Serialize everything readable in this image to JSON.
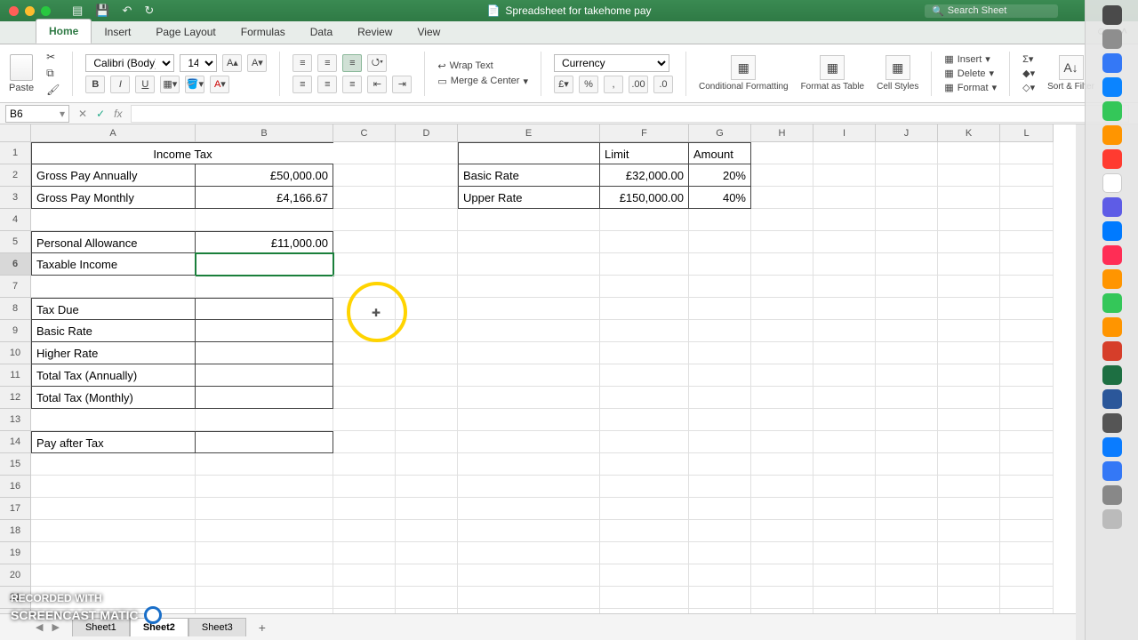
{
  "window": {
    "title": "Spreadsheet for takehome pay",
    "search_placeholder": "Search Sheet"
  },
  "tabs": [
    "Home",
    "Insert",
    "Page Layout",
    "Formulas",
    "Data",
    "Review",
    "View"
  ],
  "active_tab": "Home",
  "ribbon": {
    "paste": "Paste",
    "font_name": "Calibri (Body)",
    "font_size": "14",
    "bold": "B",
    "italic": "I",
    "underline": "U",
    "wrap": "Wrap Text",
    "merge": "Merge & Center",
    "number_format": "Currency",
    "cond": "Conditional Formatting",
    "as_table": "Format as Table",
    "cell_styles": "Cell Styles",
    "insert": "Insert",
    "delete": "Delete",
    "format": "Format",
    "sort": "Sort & Filter"
  },
  "namebox": "B6",
  "fx_label": "fx",
  "columns": [
    "A",
    "B",
    "C",
    "D",
    "E",
    "F",
    "G",
    "H",
    "I",
    "J",
    "K",
    "L"
  ],
  "row_count": 22,
  "selected_row": 6,
  "cells": {
    "title": "Income Tax",
    "a2": "Gross Pay Annually",
    "b2": "£50,000.00",
    "a3": "Gross Pay Monthly",
    "b3": "£4,166.67",
    "a5": "Personal Allowance",
    "b5": "£11,000.00",
    "a6": "Taxable Income",
    "a8": "Tax Due",
    "a9": "Basic Rate",
    "a10": "Higher Rate",
    "a11": "Total Tax (Annually)",
    "a12": "Total Tax (Monthly)",
    "a14": "Pay after Tax",
    "f1": "Limit",
    "g1": "Amount",
    "e2": "Basic Rate",
    "f2": "£32,000.00",
    "g2": "20%",
    "e3": "Upper Rate",
    "f3": "£150,000.00",
    "g3": "40%"
  },
  "sheet_tabs": [
    "Sheet1",
    "Sheet2",
    "Sheet3"
  ],
  "active_sheet": "Sheet2",
  "watermark_top": "RECORDED WITH",
  "watermark_bottom": "SCREENCAST   MATIC"
}
